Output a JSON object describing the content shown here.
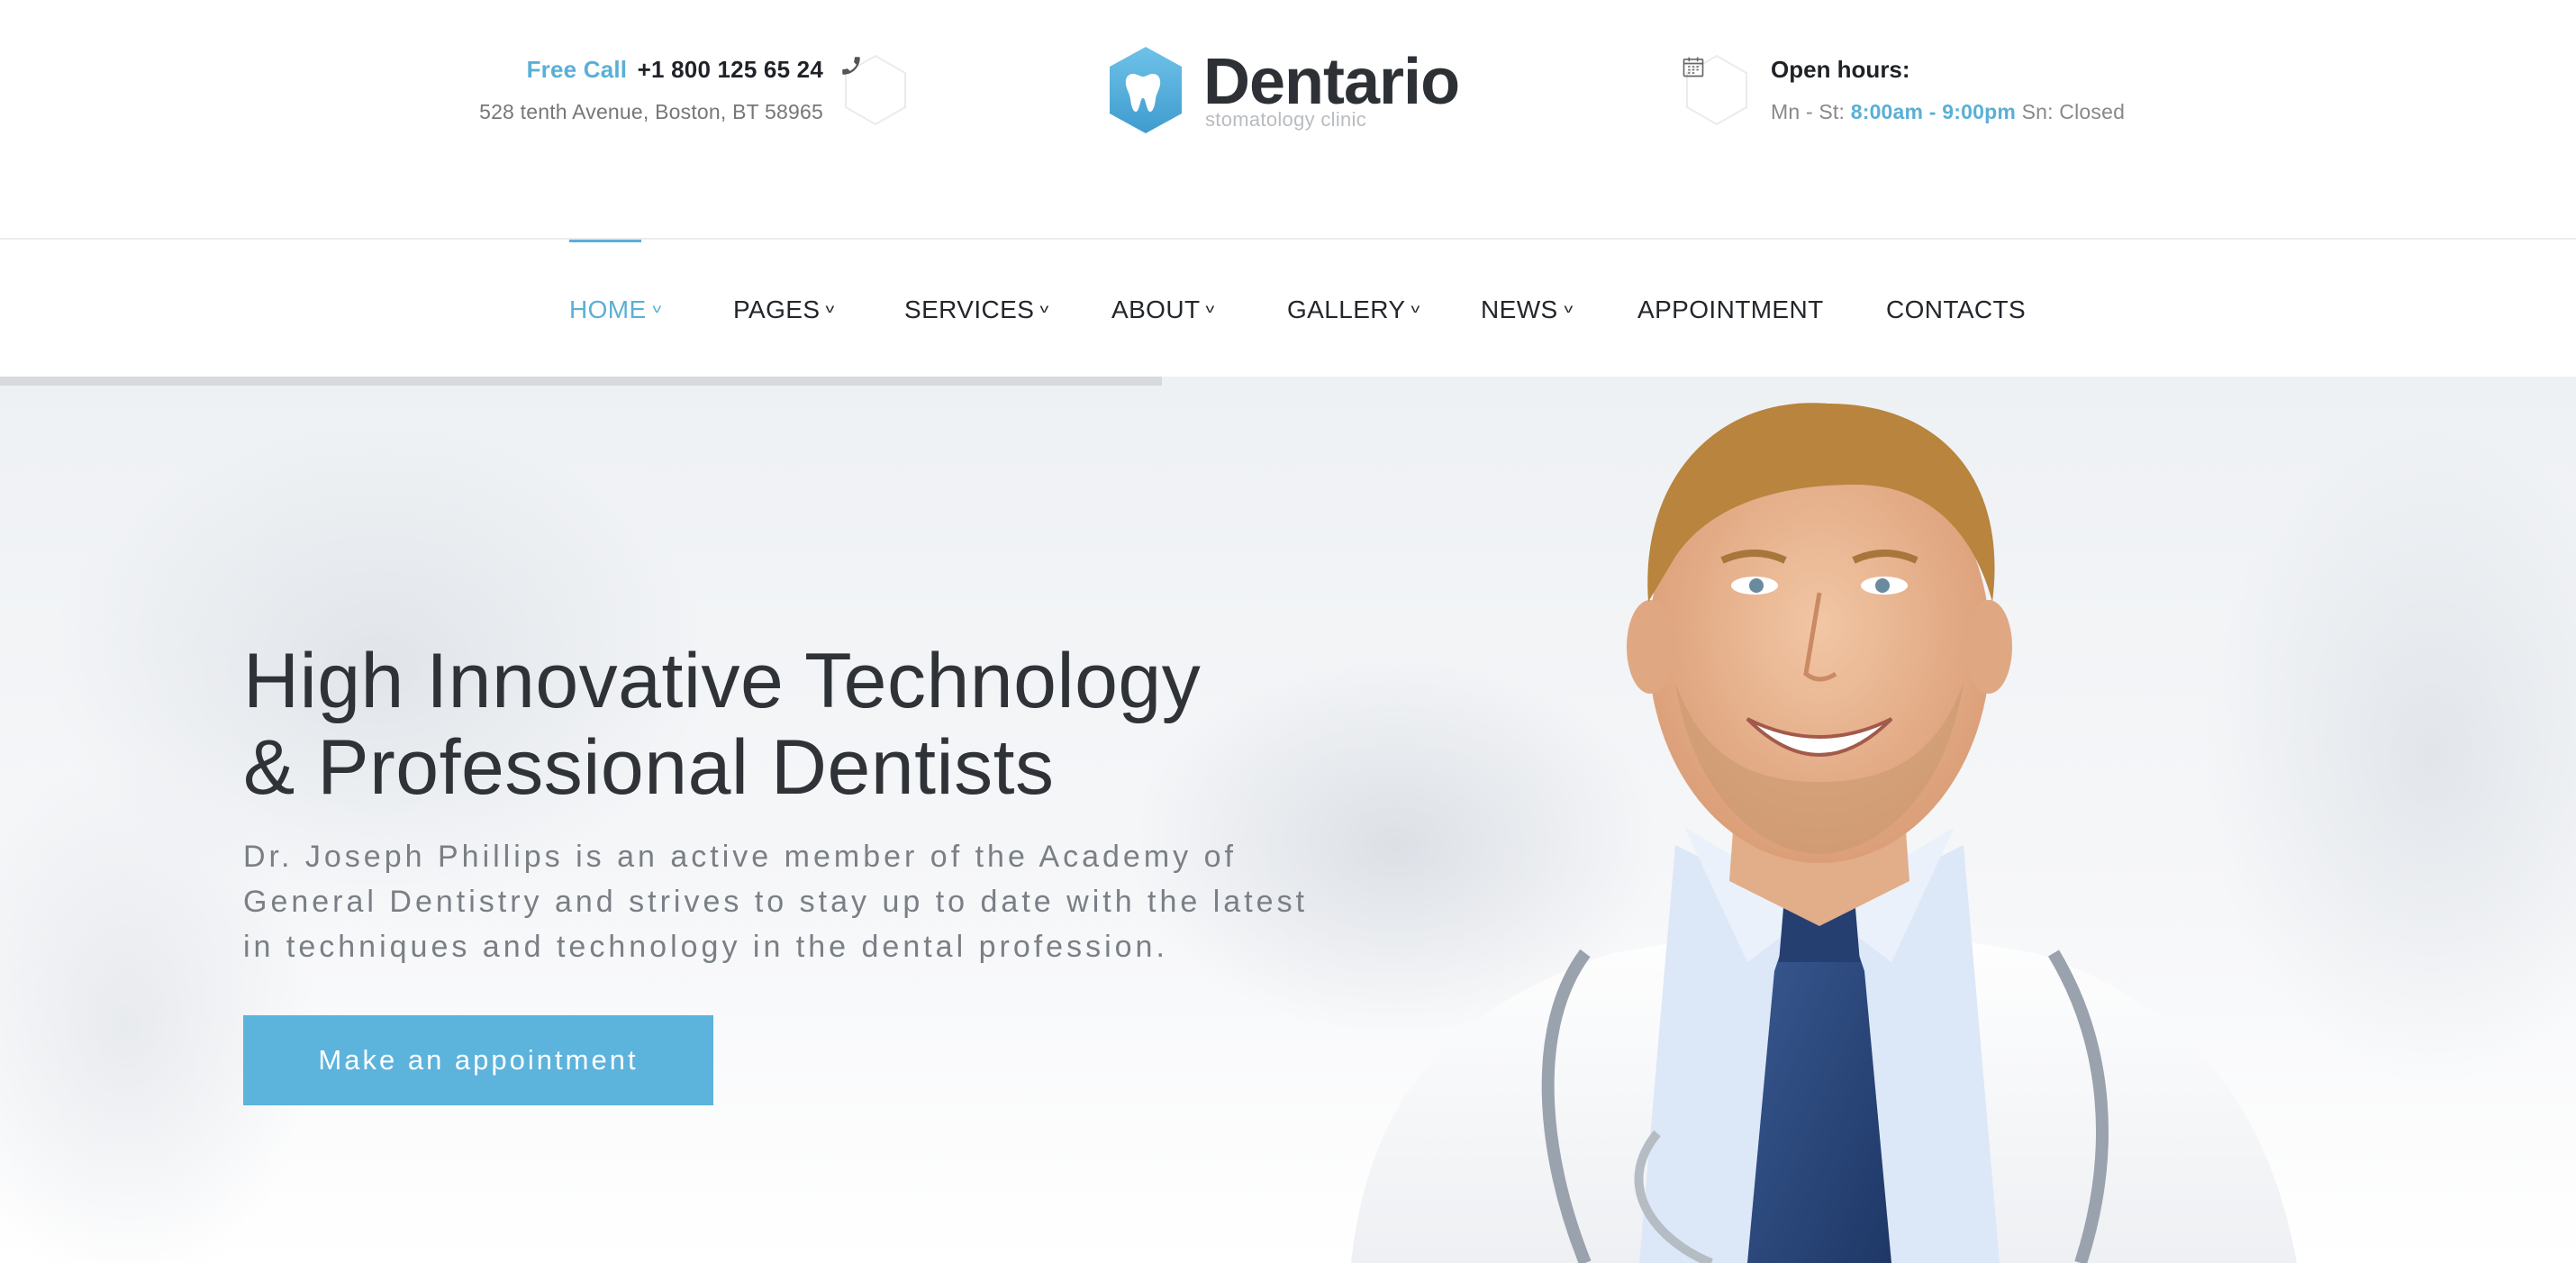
{
  "header": {
    "free_call_label": "Free Call",
    "phone": "+1 800 125 65 24",
    "address": "528 tenth Avenue, Boston, BT 58965",
    "logo_name": "Dentario",
    "logo_tagline": "stomatology clinic",
    "hours_title": "Open hours:",
    "hours_prefix": "Mn - St:",
    "hours_time": "8:00am - 9:00pm",
    "hours_suffix": "Sn: Closed",
    "phone_icon": "phone-icon",
    "calendar_icon": "calendar-icon"
  },
  "nav": {
    "items": [
      {
        "label": "HOME",
        "active": true,
        "dropdown": true
      },
      {
        "label": "PAGES",
        "active": false,
        "dropdown": true
      },
      {
        "label": "SERVICES",
        "active": false,
        "dropdown": true
      },
      {
        "label": "ABOUT",
        "active": false,
        "dropdown": true
      },
      {
        "label": "GALLERY",
        "active": false,
        "dropdown": true
      },
      {
        "label": "NEWS",
        "active": false,
        "dropdown": true
      },
      {
        "label": "APPOINTMENT",
        "active": false,
        "dropdown": false
      },
      {
        "label": "CONTACTS",
        "active": false,
        "dropdown": false
      }
    ]
  },
  "hero": {
    "title_line1": "High Innovative Technology",
    "title_line2": "& Professional Dentists",
    "desc_line1": "Dr. Joseph Phillips is an active member of the Academy of",
    "desc_line2": "General Dentistry and strives to stay up to date with the latest",
    "desc_line3": "in techniques and technology in the dental profession.",
    "cta_label": "Make an appointment"
  },
  "colors": {
    "accent": "#5aafd6",
    "button": "#5cb3dc",
    "text_dark": "#23262b",
    "text_muted": "#777777"
  }
}
